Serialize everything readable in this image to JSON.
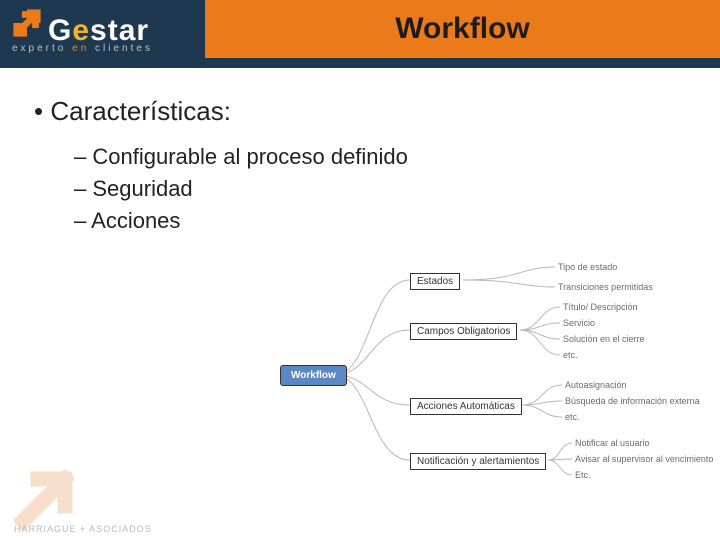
{
  "brand": {
    "name_part1": "G",
    "name_part2": "e",
    "name_part3": "star",
    "tag_pre": "experto",
    "tag_mid": "en",
    "tag_post": "clientes"
  },
  "title": "Workflow",
  "heading": "Características:",
  "bullets": [
    "Configurable al proceso definido",
    "Seguridad",
    "Acciones"
  ],
  "diagram": {
    "root": "Workflow",
    "branches": [
      {
        "label": "Estados",
        "children": [
          "Tipo de estado",
          "Transiciones permitidas"
        ]
      },
      {
        "label": "Campos Obligatorios",
        "children": [
          "Título/ Descripción",
          "Servicio",
          "Solución en el cierre",
          "etc."
        ]
      },
      {
        "label": "Acciones Automáticas",
        "children": [
          "Autoasignación",
          "Búsqueda de información externa",
          "etc."
        ]
      },
      {
        "label": "Notificación y alertamientos",
        "children": [
          "Notificar al usuario",
          "Avisar al supervisor al vencimiento",
          "Etc."
        ]
      }
    ]
  },
  "footer": "HARRIAGUE + ASOCIADOS"
}
